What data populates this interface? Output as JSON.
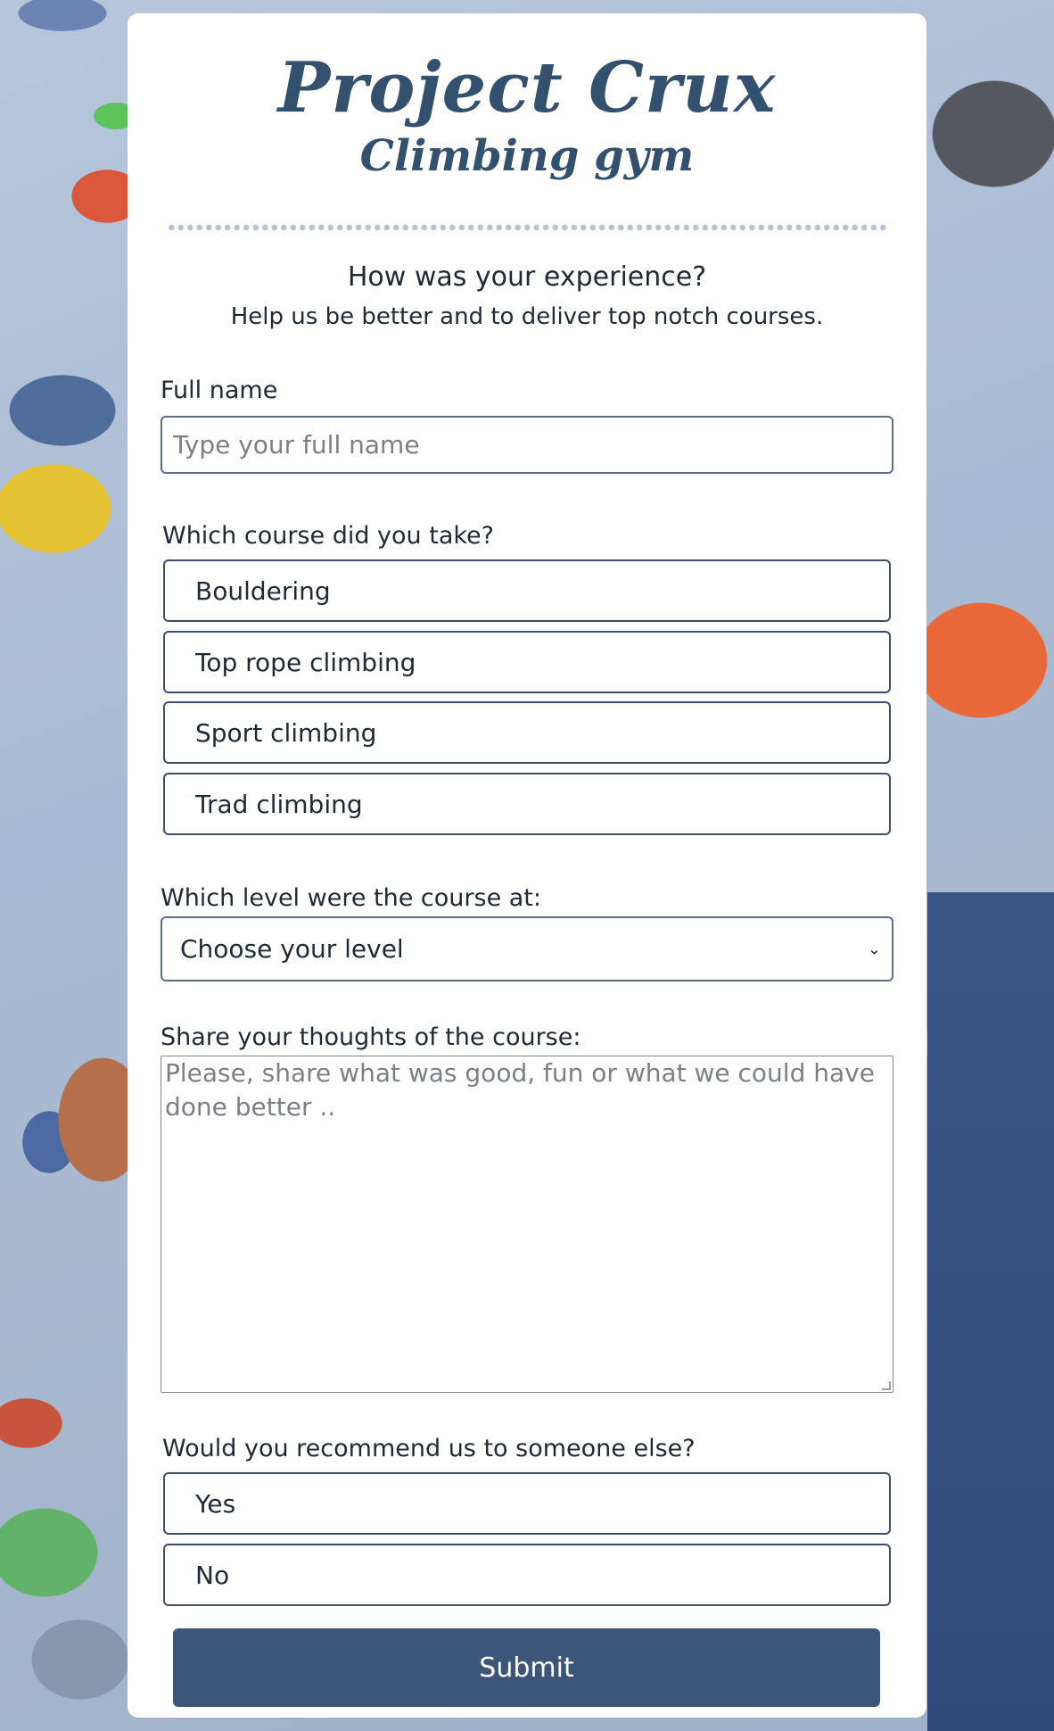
{
  "brand": {
    "title": "Project Crux",
    "subtitle": "Climbing gym"
  },
  "intro": {
    "heading": "How was your experience?",
    "subheading": "Help us be better and to deliver top notch courses."
  },
  "fullname": {
    "label": "Full name",
    "placeholder": "Type your full name"
  },
  "course": {
    "label": "Which course did you take?",
    "options": [
      "Bouldering",
      "Top rope climbing",
      "Sport climbing",
      "Trad climbing"
    ]
  },
  "level": {
    "label": "Which level were the course at:",
    "selected": "Choose your level"
  },
  "thoughts": {
    "label": "Share your thoughts of the course:",
    "placeholder": "Please, share what was good, fun or what we could have done better .."
  },
  "recommend": {
    "label": "Would you recommend us to someone else?",
    "options": [
      "Yes",
      "No"
    ]
  },
  "submit_label": "Submit",
  "colors": {
    "accent": "#3b5679",
    "brand": "#33506f",
    "border": "#3d4f6b"
  }
}
